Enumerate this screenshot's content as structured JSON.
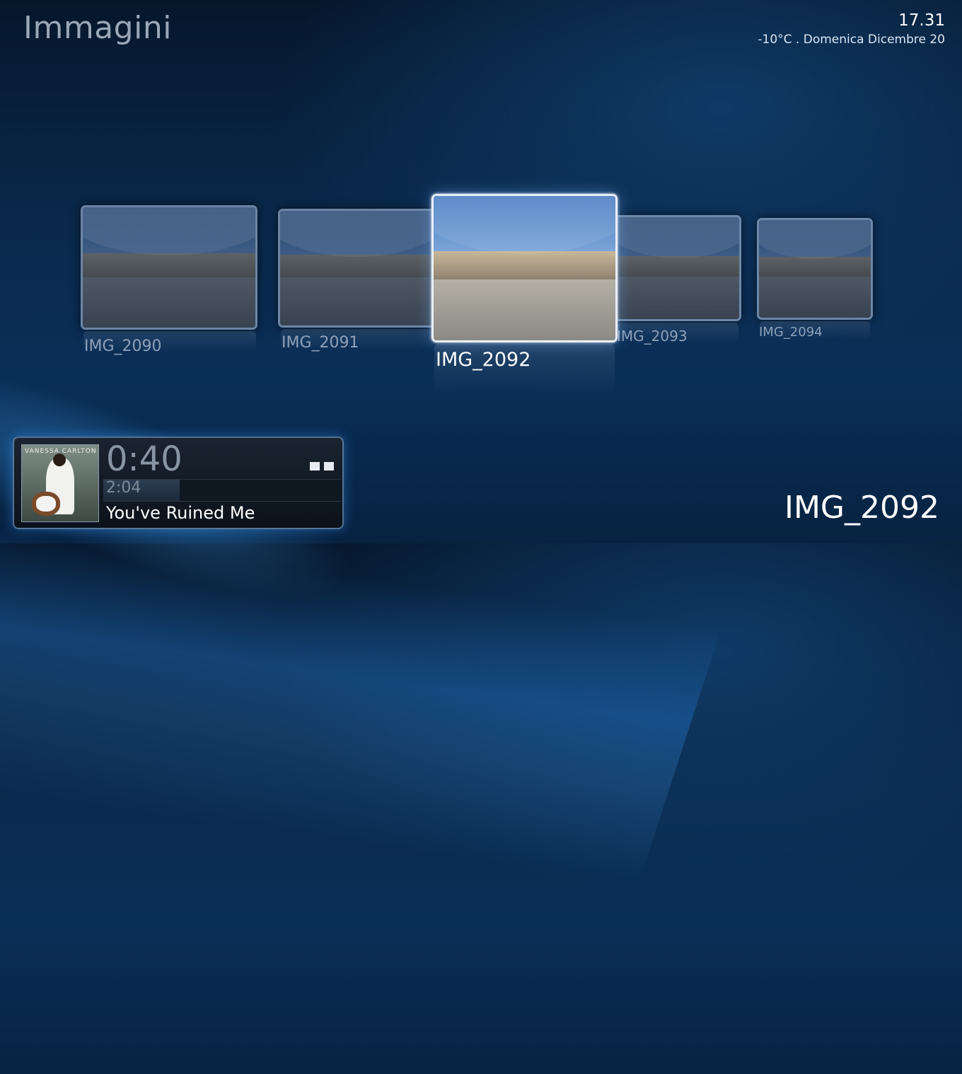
{
  "header": {
    "title": "Immagini",
    "time": "17.31",
    "dateline": "-10°C  .  Domenica Dicembre 20"
  },
  "gallery": {
    "items": [
      {
        "label": "IMG_2090"
      },
      {
        "label": "IMG_2091"
      },
      {
        "label": "IMG_2092"
      },
      {
        "label": "IMG_2093"
      },
      {
        "label": "IMG_2094"
      }
    ],
    "selected": "IMG_2092"
  },
  "now_playing": {
    "album_art_text": "VANESSA CARLTON",
    "elapsed": "0:40",
    "duration": "2:04",
    "progress": 0.32,
    "track": "You've Ruined Me"
  },
  "colors": {
    "accent": "#4aa3ff",
    "background": "#0a2a4e"
  },
  "icons": {
    "pause": "pause-icon"
  }
}
